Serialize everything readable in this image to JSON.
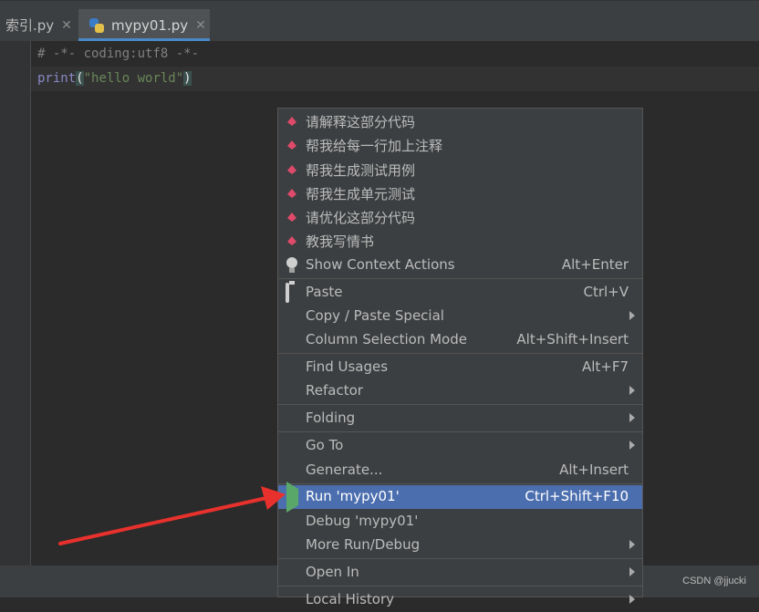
{
  "tabs": [
    {
      "label": "索引.py",
      "active": false
    },
    {
      "label": "mypy01.py",
      "active": true
    }
  ],
  "editor": {
    "line1": "# -*- coding:utf8 -*-",
    "line2_func": "print",
    "line2_open": "(",
    "line2_string": "\"hello world\"",
    "line2_close": ")"
  },
  "context_menu": {
    "items": [
      {
        "label": "请解释这部分代码",
        "icon": "lotus-icon"
      },
      {
        "label": "帮我给每一行加上注释",
        "icon": "lotus-icon"
      },
      {
        "label": "帮我生成测试用例",
        "icon": "lotus-icon"
      },
      {
        "label": "帮我生成单元测试",
        "icon": "lotus-icon"
      },
      {
        "label": "请优化这部分代码",
        "icon": "lotus-icon"
      },
      {
        "label": "教我写情书",
        "icon": "lotus-icon"
      },
      {
        "label": "Show Context Actions",
        "shortcut": "Alt+Enter",
        "icon": "lightbulb-icon"
      },
      {
        "label": "Paste",
        "shortcut": "Ctrl+V",
        "icon": "clipboard-icon"
      },
      {
        "label": "Copy / Paste Special",
        "submenu": true
      },
      {
        "label": "Column Selection Mode",
        "shortcut": "Alt+Shift+Insert"
      },
      {
        "label": "Find Usages",
        "shortcut": "Alt+F7"
      },
      {
        "label": "Refactor",
        "submenu": true
      },
      {
        "label": "Folding",
        "submenu": true
      },
      {
        "label": "Go To",
        "submenu": true
      },
      {
        "label": "Generate...",
        "shortcut": "Alt+Insert"
      },
      {
        "label": "Run 'mypy01'",
        "shortcut": "Ctrl+Shift+F10",
        "icon": "run-icon",
        "selected": true
      },
      {
        "label": "Debug 'mypy01'",
        "icon": "debug-icon"
      },
      {
        "label": "More Run/Debug",
        "submenu": true
      },
      {
        "label": "Open In",
        "submenu": true
      },
      {
        "label": "Local History",
        "submenu": true
      }
    ]
  },
  "watermark": "CSDN @jjucki",
  "colors": {
    "menu_selected": "#4b6eaf",
    "annotation_arrow": "#e8312c",
    "run_green": "#59a869"
  }
}
